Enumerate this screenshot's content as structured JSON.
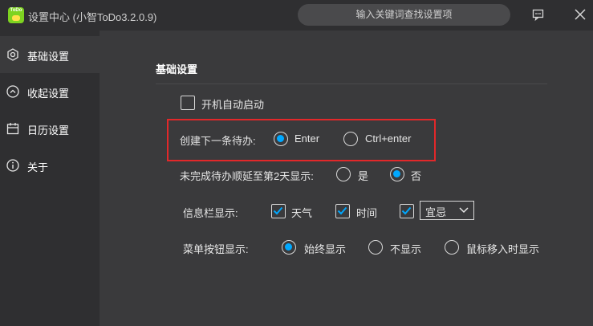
{
  "titlebar": {
    "app_title": "设置中心 (小智ToDo3.2.0.9)",
    "logo_text": "ToDo",
    "search_placeholder": "输入关键词查找设置项"
  },
  "sidebar": {
    "items": [
      {
        "label": "基础设置",
        "icon": "gear-icon",
        "active": true
      },
      {
        "label": "收起设置",
        "icon": "collapse-icon",
        "active": false
      },
      {
        "label": "日历设置",
        "icon": "calendar-icon",
        "active": false
      },
      {
        "label": "关于",
        "icon": "info-icon",
        "active": false
      }
    ]
  },
  "main": {
    "section_title": "基础设置",
    "autostart": {
      "label": "开机自动启动",
      "checked": false
    },
    "create_todo": {
      "label": "创建下一条待办:",
      "options": [
        {
          "label": "Enter",
          "checked": true
        },
        {
          "label": "Ctrl+enter",
          "checked": false
        }
      ]
    },
    "defer_unfinished": {
      "label": "未完成待办顺延至第2天显示:",
      "options": [
        {
          "label": "是",
          "checked": false
        },
        {
          "label": "否",
          "checked": true
        }
      ]
    },
    "info_bar": {
      "label": "信息栏显示:",
      "options": [
        {
          "label": "天气",
          "checked": true
        },
        {
          "label": "时间",
          "checked": true
        },
        {
          "label": "宜忌",
          "checked": true
        }
      ]
    },
    "menu_button": {
      "label": "菜单按钮显示:",
      "options": [
        {
          "label": "始终显示",
          "checked": true
        },
        {
          "label": "不显示",
          "checked": false
        },
        {
          "label": "鼠标移入时显示",
          "checked": false
        }
      ]
    }
  },
  "colors": {
    "accent": "#00a8ff",
    "highlight_border": "#e2282a",
    "background": "#3a3a3c",
    "sidebar": "#2f2f31"
  }
}
